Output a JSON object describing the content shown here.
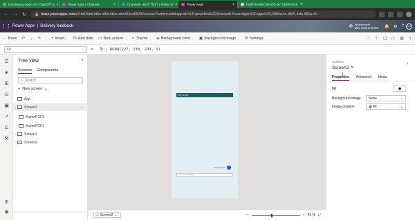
{
  "browser": {
    "tabs": [
      {
        "title": "Introducing Open AI's ChatGPT a",
        "color": "#74aa9c"
      },
      {
        "title": "Power Apps | Chatbots",
        "color": "#c04fc0"
      },
      {
        "title": "Channels - BOT TEST | Power Vi",
        "color": "#2a8fe0"
      },
      {
        "title": "Power Apps",
        "color": "#c04fc0",
        "active": true
      },
      {
        "title": "MSDYNAMICSBLOG BY DEEPESH",
        "color": "#333333"
      }
    ],
    "new_tab": "+",
    "url_host": "make.powerapps.com",
    "url_path": "/e/1fa825dd-fd5e-e8fe-bbce-abe344e4650f6/canvas/?action=edit&app-id=%2Fproviders%2FMicrosoft.PowerApps%2Fapps%2F449bbe4e-d905-4cfa-896a-c6..."
  },
  "header": {
    "app_name": "Power Apps",
    "separator": "|",
    "app_title": "Delivery feedback",
    "env_label": "Environment",
    "env_name": "Dev environment",
    "avatar": "CA"
  },
  "commands": {
    "back": "Back",
    "insert": "Insert",
    "add_data": "Add data",
    "new_screen": "New screen",
    "theme": "Theme",
    "background_color": "Background color",
    "background_image": "Background image",
    "settings": "Settings"
  },
  "formula_bar": {
    "property": "Fill",
    "equals": "=",
    "fx": "fx",
    "formula": "RGBA(227, 238, 243, 1)"
  },
  "tree": {
    "title": "Tree view",
    "tabs": [
      "Screens",
      "Components"
    ],
    "search_placeholder": "Search",
    "new_screen": "New screen",
    "nodes": [
      "App",
      "Screen2",
      "IframePCF3",
      "IframePCF1",
      "Screen1",
      "Screen3"
    ]
  },
  "canvas": {
    "screen_header_text": "BOT TEST",
    "bot_message": "Power apps",
    "input_placeholder": "Type your message"
  },
  "status": {
    "screen": "Screen2",
    "zoom_minus": "—",
    "zoom_plus": "+",
    "zoom": "41",
    "zoom_unit": "%"
  },
  "properties": {
    "kind": "SCREEN",
    "name": "Screen2",
    "tabs": [
      "Properties",
      "Advanced",
      "Ideas"
    ],
    "fill_label": "Fill",
    "fill_value": "RGBA(227, 238, 243, 1)",
    "background_image_label": "Background image",
    "background_image_value": "None",
    "image_position_label": "Image position",
    "image_position_value": "Fit"
  }
}
